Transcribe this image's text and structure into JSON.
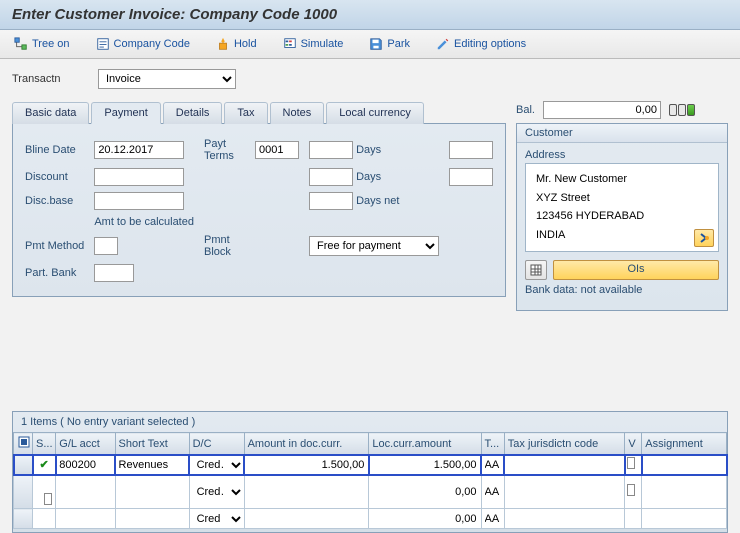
{
  "title": "Enter Customer Invoice: Company Code 1000",
  "toolbar": {
    "tree_on": "Tree on",
    "company_code": "Company Code",
    "hold": "Hold",
    "simulate": "Simulate",
    "park": "Park",
    "editing_options": "Editing options"
  },
  "transaction": {
    "label": "Transactn",
    "value": "Invoice"
  },
  "balance": {
    "label": "Bal.",
    "value": "0,00"
  },
  "tabs": [
    "Basic data",
    "Payment",
    "Details",
    "Tax",
    "Notes",
    "Local currency"
  ],
  "active_tab": "Payment",
  "payment_form": {
    "bline_date_lbl": "Bline Date",
    "bline_date": "20.12.2017",
    "payt_terms_lbl": "Payt Terms",
    "payt_terms": "0001",
    "days_lbl": "Days",
    "days1_v": "",
    "days1_d": "",
    "discount_lbl": "Discount",
    "discount": "",
    "days2_lbl": "Days",
    "days2_v": "",
    "days2_d": "",
    "disc_base_lbl": "Disc.base",
    "disc_base": "",
    "days_net_lbl": "Days net",
    "days_net": "",
    "amt_calc": "Amt to be calculated",
    "pmt_method_lbl": "Pmt Method",
    "pmt_method": "",
    "pmnt_block_lbl": "Pmnt Block",
    "pmnt_block": "Free for payment",
    "part_bank_lbl": "Part. Bank",
    "part_bank": ""
  },
  "customer_panel": {
    "title": "Customer",
    "address_title": "Address",
    "name": "Mr. New Customer",
    "street": "XYZ Street",
    "city": "123456 HYDERABAD",
    "country": "INDIA",
    "ois_label": "OIs",
    "bank_text": "Bank data: not available"
  },
  "items_header": "1 Items ( No entry variant selected )",
  "grid": {
    "columns": [
      "S...",
      "G/L acct",
      "Short Text",
      "D/C",
      "Amount in doc.curr.",
      "Loc.curr.amount",
      "T...",
      "Tax jurisdictn code",
      "V",
      "Assignment"
    ],
    "row_a": {
      "gl": "800200",
      "short": "Revenues",
      "dc": "Cred…",
      "amount": "1.500,00",
      "loc": "1.500,00",
      "t": "AA",
      "tj": "",
      "asg": ""
    },
    "row_b": {
      "gl": "",
      "short": "",
      "dc": "Cred…",
      "amount": "",
      "loc": "0,00",
      "t": "AA",
      "tj": "",
      "asg": ""
    },
    "row_c": {
      "gl": "",
      "short": "",
      "dc": "Cred",
      "amount": "",
      "loc": "0,00",
      "t": "AA",
      "tj": "",
      "asg": ""
    }
  }
}
